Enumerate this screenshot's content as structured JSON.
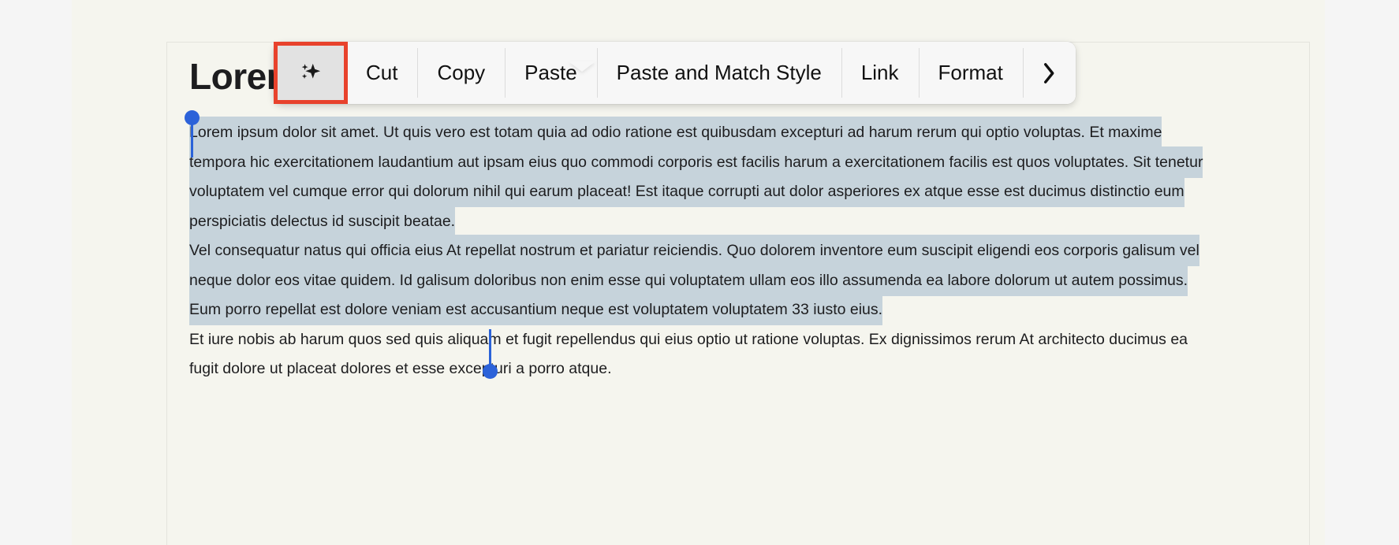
{
  "window": {
    "background_color": "#f5f5f5",
    "page_color": "#f5f5ee"
  },
  "document": {
    "heading": "Lorem",
    "selection_highlight_color": "#c6d3db",
    "handle_color": "#2c62d9",
    "paragraphs": [
      {
        "id": "p1",
        "selected": true,
        "text": "Lorem ipsum dolor sit amet. Ut quis vero est totam quia ad odio ratione est quibusdam excepturi ad harum rerum qui optio voluptas. Et maxime tempora hic exercitationem laudantium aut ipsam eius quo commodi corporis est facilis harum a exercitationem facilis est quos voluptates. Sit tenetur voluptatem vel cumque error qui dolorum nihil qui earum placeat! Est itaque corrupti aut dolor asperiores ex atque esse est ducimus distinctio eum perspiciatis delectus id suscipit beatae."
      },
      {
        "id": "p2",
        "selected": true,
        "text": "Vel consequatur natus qui officia eius At repellat nostrum et pariatur reiciendis. Quo dolorem inventore eum suscipit eligendi eos corporis galisum vel neque dolor eos vitae quidem. Id galisum doloribus non enim esse qui voluptatem ullam eos illo assumenda ea labore dolorum ut autem possimus. Eum porro repellat est dolore veniam est accusantium neque est voluptatem voluptatem 33 iusto eius."
      },
      {
        "id": "p3",
        "selected": false,
        "text": "Et iure nobis ab harum quos sed quis aliquam et fugit repellendus qui eius optio ut ratione voluptas. Ex dignissimos rerum At architecto ducimus ea fugit dolore ut placeat dolores et esse excepturi a porro atque."
      }
    ]
  },
  "context_menu": {
    "items": [
      {
        "id": "ai",
        "label": "",
        "icon": "sparkle-icon",
        "active": true
      },
      {
        "id": "cut",
        "label": "Cut",
        "icon": null,
        "active": false
      },
      {
        "id": "copy",
        "label": "Copy",
        "icon": null,
        "active": false
      },
      {
        "id": "paste",
        "label": "Paste",
        "icon": null,
        "active": false
      },
      {
        "id": "paste_match",
        "label": "Paste and Match Style",
        "icon": null,
        "active": false
      },
      {
        "id": "link",
        "label": "Link",
        "icon": null,
        "active": false
      },
      {
        "id": "format",
        "label": "Format",
        "icon": null,
        "active": false
      },
      {
        "id": "more",
        "label": "",
        "icon": "chevron-right-icon",
        "active": false
      }
    ]
  },
  "annotation": {
    "highlight_color": "#e8422c",
    "target": "ai-sparkle-button"
  }
}
